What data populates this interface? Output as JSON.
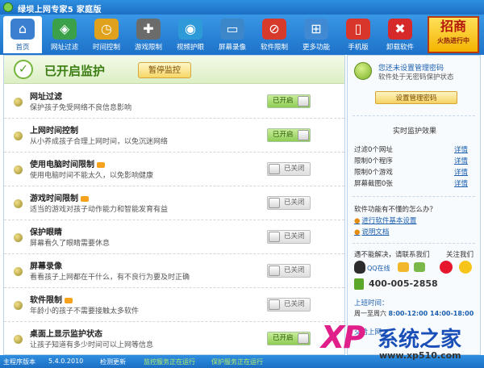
{
  "window": {
    "title": "绿坝上网专家5 家庭版"
  },
  "toolbar": {
    "items": [
      {
        "label": "首页",
        "icon": "home-icon",
        "color": "#3a7fd0"
      },
      {
        "label": "网址过滤",
        "icon": "filter-icon",
        "color": "#3aa14a"
      },
      {
        "label": "时间控制",
        "icon": "clock-icon",
        "color": "#e0a21c"
      },
      {
        "label": "游戏限制",
        "icon": "gamepad-icon",
        "color": "#6b6b6b"
      },
      {
        "label": "视频护眼",
        "icon": "eye-icon",
        "color": "#2f9ad8"
      },
      {
        "label": "屏幕录像",
        "icon": "monitor-icon",
        "color": "#3c87c9"
      },
      {
        "label": "软件限制",
        "icon": "software-icon",
        "color": "#d63a2a"
      },
      {
        "label": "更多功能",
        "icon": "grid-icon",
        "color": "#3f8ad3"
      },
      {
        "label": "手机版",
        "icon": "phone-icon",
        "color": "#d8362a"
      },
      {
        "label": "卸载软件",
        "icon": "uninstall-icon",
        "color": "#d62a2a"
      }
    ],
    "promo": {
      "big": "招商",
      "small": "火热进行中"
    }
  },
  "status": {
    "title": "已开启监护",
    "pause_label": "暂停监控"
  },
  "features": [
    {
      "title": "网址过滤",
      "desc": "保护孩子免受网络不良信息影响",
      "state": "on",
      "toggle_label": "已开启",
      "new": false
    },
    {
      "title": "上网时间控制",
      "desc": "从小养成孩子合理上网时间，以免沉迷网络",
      "state": "on",
      "toggle_label": "已开启",
      "new": false
    },
    {
      "title": "使用电脑时间限制",
      "desc": "使用电脑时间不能太久，以免影响健康",
      "state": "off",
      "toggle_label": "已关闭",
      "new": true
    },
    {
      "title": "游戏时间限制",
      "desc": "适当的游戏对孩子动作能力和智能发育有益",
      "state": "off",
      "toggle_label": "已关闭",
      "new": true
    },
    {
      "title": "保护眼睛",
      "desc": "屏幕看久了眼睛需要休息",
      "state": "off",
      "toggle_label": "已关闭",
      "new": false
    },
    {
      "title": "屏幕录像",
      "desc": "看看孩子上网都在干什么，有不良行为要及时正确",
      "state": "off",
      "toggle_label": "已关闭",
      "new": false
    },
    {
      "title": "软件限制",
      "desc": "年龄小的孩子不需要接触太多软件",
      "state": "off",
      "toggle_label": "已关闭",
      "new": true
    },
    {
      "title": "桌面上显示监护状态",
      "desc": "让孩子知道有多少时间可以上网等信息",
      "state": "on",
      "toggle_label": "已开启",
      "new": false
    }
  ],
  "sidebar": {
    "admin_title": "您还未设置管理密码",
    "admin_sub": "软件处于无密码保护状态",
    "set_password_label": "设置管理密码",
    "stats_title": "实时监护效果",
    "stats": [
      {
        "text": "过滤0个网址",
        "link": "详情"
      },
      {
        "text": "限制0个程序",
        "link": "详情"
      },
      {
        "text": "限制0个游戏",
        "link": "详情"
      },
      {
        "text": "屏幕截图0张",
        "link": "详情"
      }
    ],
    "faq_title": "软件功能有不懂的怎么办？",
    "faq_links": [
      "进行软件基本设置",
      "说明文档"
    ],
    "contact_label": "遇不能解决，请联系我们",
    "follow_label": "关注我们",
    "qq_label": "QQ在线",
    "phone": "400-005-2858",
    "hours_title": "上班时间：",
    "hours_days": "周一至周六",
    "hours_time": "8:00-12:00  14:00-18:00",
    "more_label": "交给上网"
  },
  "statusbar": {
    "items": [
      {
        "text": "主程序版本",
        "green": false
      },
      {
        "text": "5.4.0.2010",
        "green": false
      },
      {
        "text": "检测更新",
        "green": false
      },
      {
        "text": "监控服务正在运行",
        "green": true
      },
      {
        "text": "保护服务正在运行",
        "green": true
      }
    ]
  },
  "watermark": {
    "xp": "XP",
    "title": "系统之家",
    "url": "www.xp510.com"
  }
}
